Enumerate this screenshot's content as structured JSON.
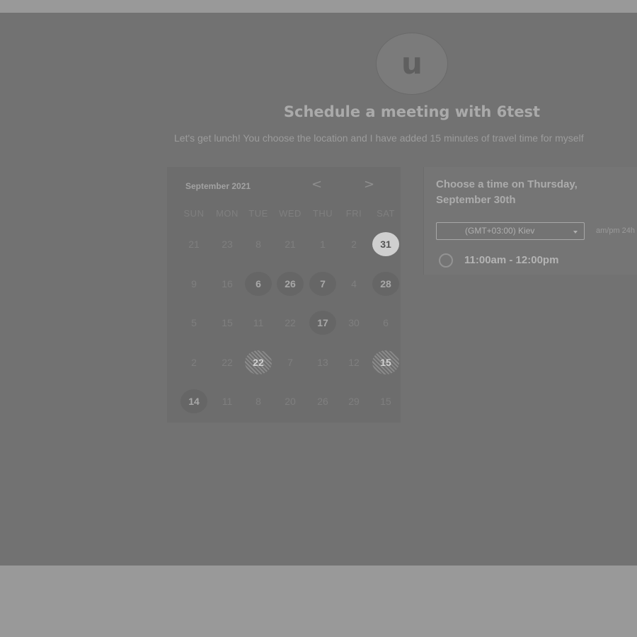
{
  "host": {
    "avatar_letter": "u",
    "title": "Schedule a meeting with 6test",
    "description": "Let's get lunch! You choose the location and I have added 15 minutes of travel time for myself"
  },
  "calendar": {
    "month_label": "September 2021",
    "prev_glyph": "<",
    "next_glyph": ">",
    "weekdays": [
      "SUN",
      "MON",
      "TUE",
      "WED",
      "THU",
      "FRI",
      "SAT"
    ],
    "weeks": [
      [
        {
          "d": "21"
        },
        {
          "d": "23"
        },
        {
          "d": "8"
        },
        {
          "d": "21"
        },
        {
          "d": "1"
        },
        {
          "d": "2"
        },
        {
          "d": "31",
          "avail": true,
          "style": "s31"
        }
      ],
      [
        {
          "d": "9"
        },
        {
          "d": "16"
        },
        {
          "d": "6",
          "avail": true
        },
        {
          "d": "26",
          "avail": true
        },
        {
          "d": "7",
          "avail": true
        },
        {
          "d": "4"
        },
        {
          "d": "28",
          "avail": true
        }
      ],
      [
        {
          "d": "5"
        },
        {
          "d": "15"
        },
        {
          "d": "11"
        },
        {
          "d": "22"
        },
        {
          "d": "17",
          "avail": true
        },
        {
          "d": "30"
        },
        {
          "d": "6"
        }
      ],
      [
        {
          "d": "2"
        },
        {
          "d": "22"
        },
        {
          "d": "22",
          "avail": true,
          "style": "hatched"
        },
        {
          "d": "7"
        },
        {
          "d": "13"
        },
        {
          "d": "12"
        },
        {
          "d": "15",
          "avail": true,
          "style": "hatched"
        }
      ],
      [
        {
          "d": "14",
          "avail": true
        },
        {
          "d": "11"
        },
        {
          "d": "8"
        },
        {
          "d": "20"
        },
        {
          "d": "26"
        },
        {
          "d": "29"
        },
        {
          "d": "15"
        }
      ]
    ]
  },
  "time_panel": {
    "heading": "Choose a time on Thursday, September 30th",
    "timezone": "(GMT+03:00) Kiev",
    "format_label": "am/pm  24h",
    "slots": [
      "11:00am - 12:00pm"
    ]
  }
}
